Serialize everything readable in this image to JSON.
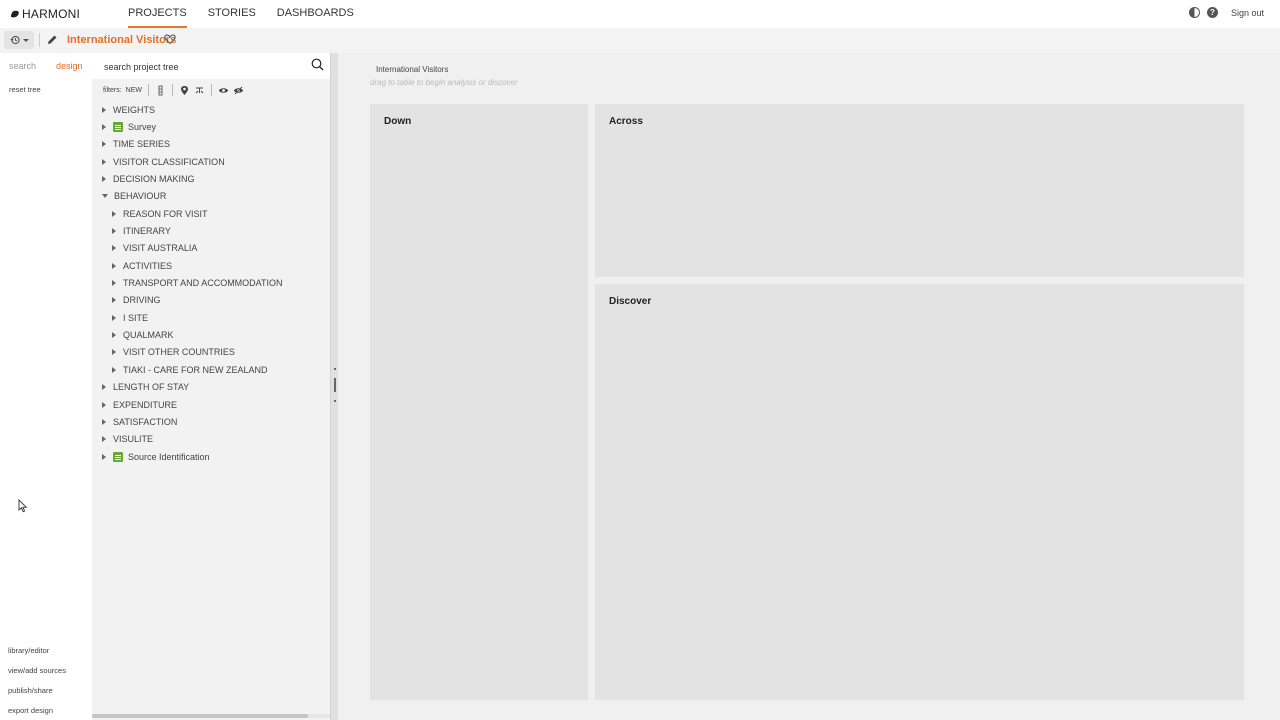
{
  "app": {
    "brand": "HARMONI",
    "nav": [
      {
        "label": "PROJECTS",
        "active": true
      },
      {
        "label": "STORIES",
        "active": false
      },
      {
        "label": "DASHBOARDS",
        "active": false
      }
    ],
    "signout": "Sign out",
    "accent_color": "#e0702a"
  },
  "project": {
    "title": "International Visitors"
  },
  "left_panel": {
    "tab_search": "search",
    "tab_design": "design",
    "reset_tree": "reset tree",
    "bottom_links": [
      "library/editor",
      "view/add sources",
      "publish/share",
      "export design"
    ]
  },
  "tree_panel": {
    "search_placeholder": "search project tree",
    "filters_label": "filters:",
    "filters_new": "NEW",
    "nodes": [
      {
        "label": "WEIGHTS",
        "level": 0,
        "expanded": false,
        "doc": false
      },
      {
        "label": "Survey",
        "level": 0,
        "expanded": false,
        "doc": true
      },
      {
        "label": "TIME SERIES",
        "level": 0,
        "expanded": false,
        "doc": false
      },
      {
        "label": "VISITOR CLASSIFICATION",
        "level": 0,
        "expanded": false,
        "doc": false
      },
      {
        "label": "DECISION MAKING",
        "level": 0,
        "expanded": false,
        "doc": false
      },
      {
        "label": "BEHAVIOUR",
        "level": 0,
        "expanded": true,
        "doc": false
      },
      {
        "label": "REASON FOR VISIT",
        "level": 1,
        "expanded": false,
        "doc": false
      },
      {
        "label": "ITINERARY",
        "level": 1,
        "expanded": false,
        "doc": false
      },
      {
        "label": "VISIT AUSTRALIA",
        "level": 1,
        "expanded": false,
        "doc": false
      },
      {
        "label": "ACTIVITIES",
        "level": 1,
        "expanded": false,
        "doc": false
      },
      {
        "label": "TRANSPORT AND ACCOMMODATION",
        "level": 1,
        "expanded": false,
        "doc": false
      },
      {
        "label": "DRIVING",
        "level": 1,
        "expanded": false,
        "doc": false
      },
      {
        "label": "I SITE",
        "level": 1,
        "expanded": false,
        "doc": false
      },
      {
        "label": "QUALMARK",
        "level": 1,
        "expanded": false,
        "doc": false
      },
      {
        "label": "VISIT OTHER COUNTRIES",
        "level": 1,
        "expanded": false,
        "doc": false
      },
      {
        "label": "TIAKI - CARE FOR NEW ZEALAND",
        "level": 1,
        "expanded": false,
        "doc": false
      },
      {
        "label": "LENGTH OF STAY",
        "level": 0,
        "expanded": false,
        "doc": false
      },
      {
        "label": "EXPENDITURE",
        "level": 0,
        "expanded": false,
        "doc": false
      },
      {
        "label": "SATISFACTION",
        "level": 0,
        "expanded": false,
        "doc": false
      },
      {
        "label": "VISULITE",
        "level": 0,
        "expanded": false,
        "doc": false
      },
      {
        "label": "Source Identification",
        "level": 0,
        "expanded": false,
        "doc": true
      }
    ]
  },
  "workspace": {
    "title": "International Visitors",
    "hint": "drag to table to begin analysis or discover",
    "down_label": "Down",
    "across_label": "Across",
    "discover_label": "Discover"
  }
}
